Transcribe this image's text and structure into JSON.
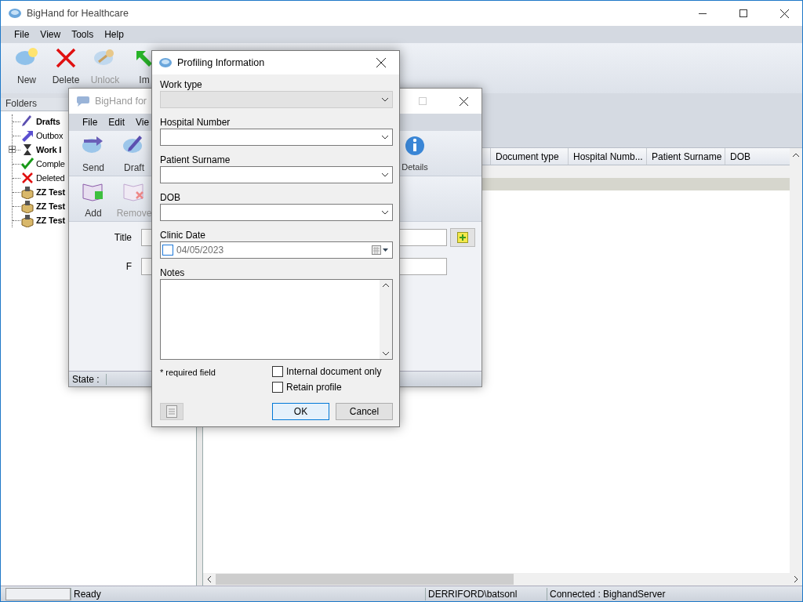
{
  "main_window": {
    "title": "BigHand for Healthcare",
    "menu": [
      "File",
      "View",
      "Tools",
      "Help"
    ],
    "toolbar": [
      {
        "label": "New",
        "kind": "new",
        "disabled": false
      },
      {
        "label": "Delete",
        "kind": "delete",
        "disabled": false
      },
      {
        "label": "Unlock",
        "kind": "unlock",
        "disabled": true
      },
      {
        "label": "Im",
        "kind": "import",
        "disabled": false
      }
    ],
    "folders": {
      "title": "Folders",
      "items": [
        {
          "label": "Drafts",
          "kind": "drafts",
          "bold": true,
          "expandable": false
        },
        {
          "label": "Outbox",
          "kind": "outbox",
          "bold": false,
          "expandable": false
        },
        {
          "label": "Work I",
          "kind": "work",
          "bold": true,
          "expandable": true
        },
        {
          "label": "Comple",
          "kind": "complete",
          "bold": false,
          "expandable": false
        },
        {
          "label": "Deleted",
          "kind": "deleted",
          "bold": false,
          "expandable": false
        },
        {
          "label": "ZZ Test",
          "kind": "box",
          "bold": true,
          "expandable": false
        },
        {
          "label": "ZZ Test",
          "kind": "box",
          "bold": true,
          "expandable": false
        },
        {
          "label": "ZZ Test",
          "kind": "box",
          "bold": true,
          "expandable": false
        }
      ]
    },
    "table": {
      "columns": [
        "Document type",
        "Hospital Numb...",
        "Patient Surname",
        "DOB"
      ],
      "rows": [
        {
          "selected": false
        },
        {
          "selected": true
        }
      ]
    },
    "status_bar": {
      "message": "Ready",
      "user": "DERRIFORD\\batsonl",
      "connection": "Connected : BighandServer"
    }
  },
  "editor_window": {
    "title": "BigHand for",
    "menu": [
      "File",
      "Edit",
      "Vie"
    ],
    "toolbar": [
      {
        "label": "Send",
        "kind": "send",
        "disabled": false
      },
      {
        "label": "Draft",
        "kind": "draft",
        "disabled": false
      }
    ],
    "toolbar_right": [
      {
        "label": "Details",
        "kind": "details",
        "disabled": false
      }
    ],
    "toolbar2": [
      {
        "label": "Add",
        "kind": "add",
        "disabled": false
      },
      {
        "label": "Remove",
        "kind": "remove",
        "disabled": true
      }
    ],
    "fields": [
      {
        "label": "Title"
      },
      {
        "label": "F"
      }
    ],
    "status_label": "State :"
  },
  "dialog": {
    "title": "Profiling Information",
    "fields": [
      {
        "label": "Work type",
        "kind": "combo",
        "disabled": true
      },
      {
        "label": "Hospital Number",
        "kind": "combo",
        "disabled": false
      },
      {
        "label": "Patient Surname",
        "kind": "combo",
        "disabled": false
      },
      {
        "label": "DOB",
        "kind": "combo",
        "disabled": false
      },
      {
        "label": "Clinic Date",
        "kind": "date",
        "value": "04/05/2023",
        "checked": false,
        "disabled": false
      },
      {
        "label": "Notes",
        "kind": "notes",
        "disabled": false
      }
    ],
    "required_note": "* required field",
    "options": [
      {
        "label": "Internal document only",
        "checked": false
      },
      {
        "label": "Retain profile",
        "checked": false
      }
    ],
    "buttons": [
      {
        "label": "OK",
        "default": true
      },
      {
        "label": "Cancel",
        "default": false
      }
    ]
  }
}
